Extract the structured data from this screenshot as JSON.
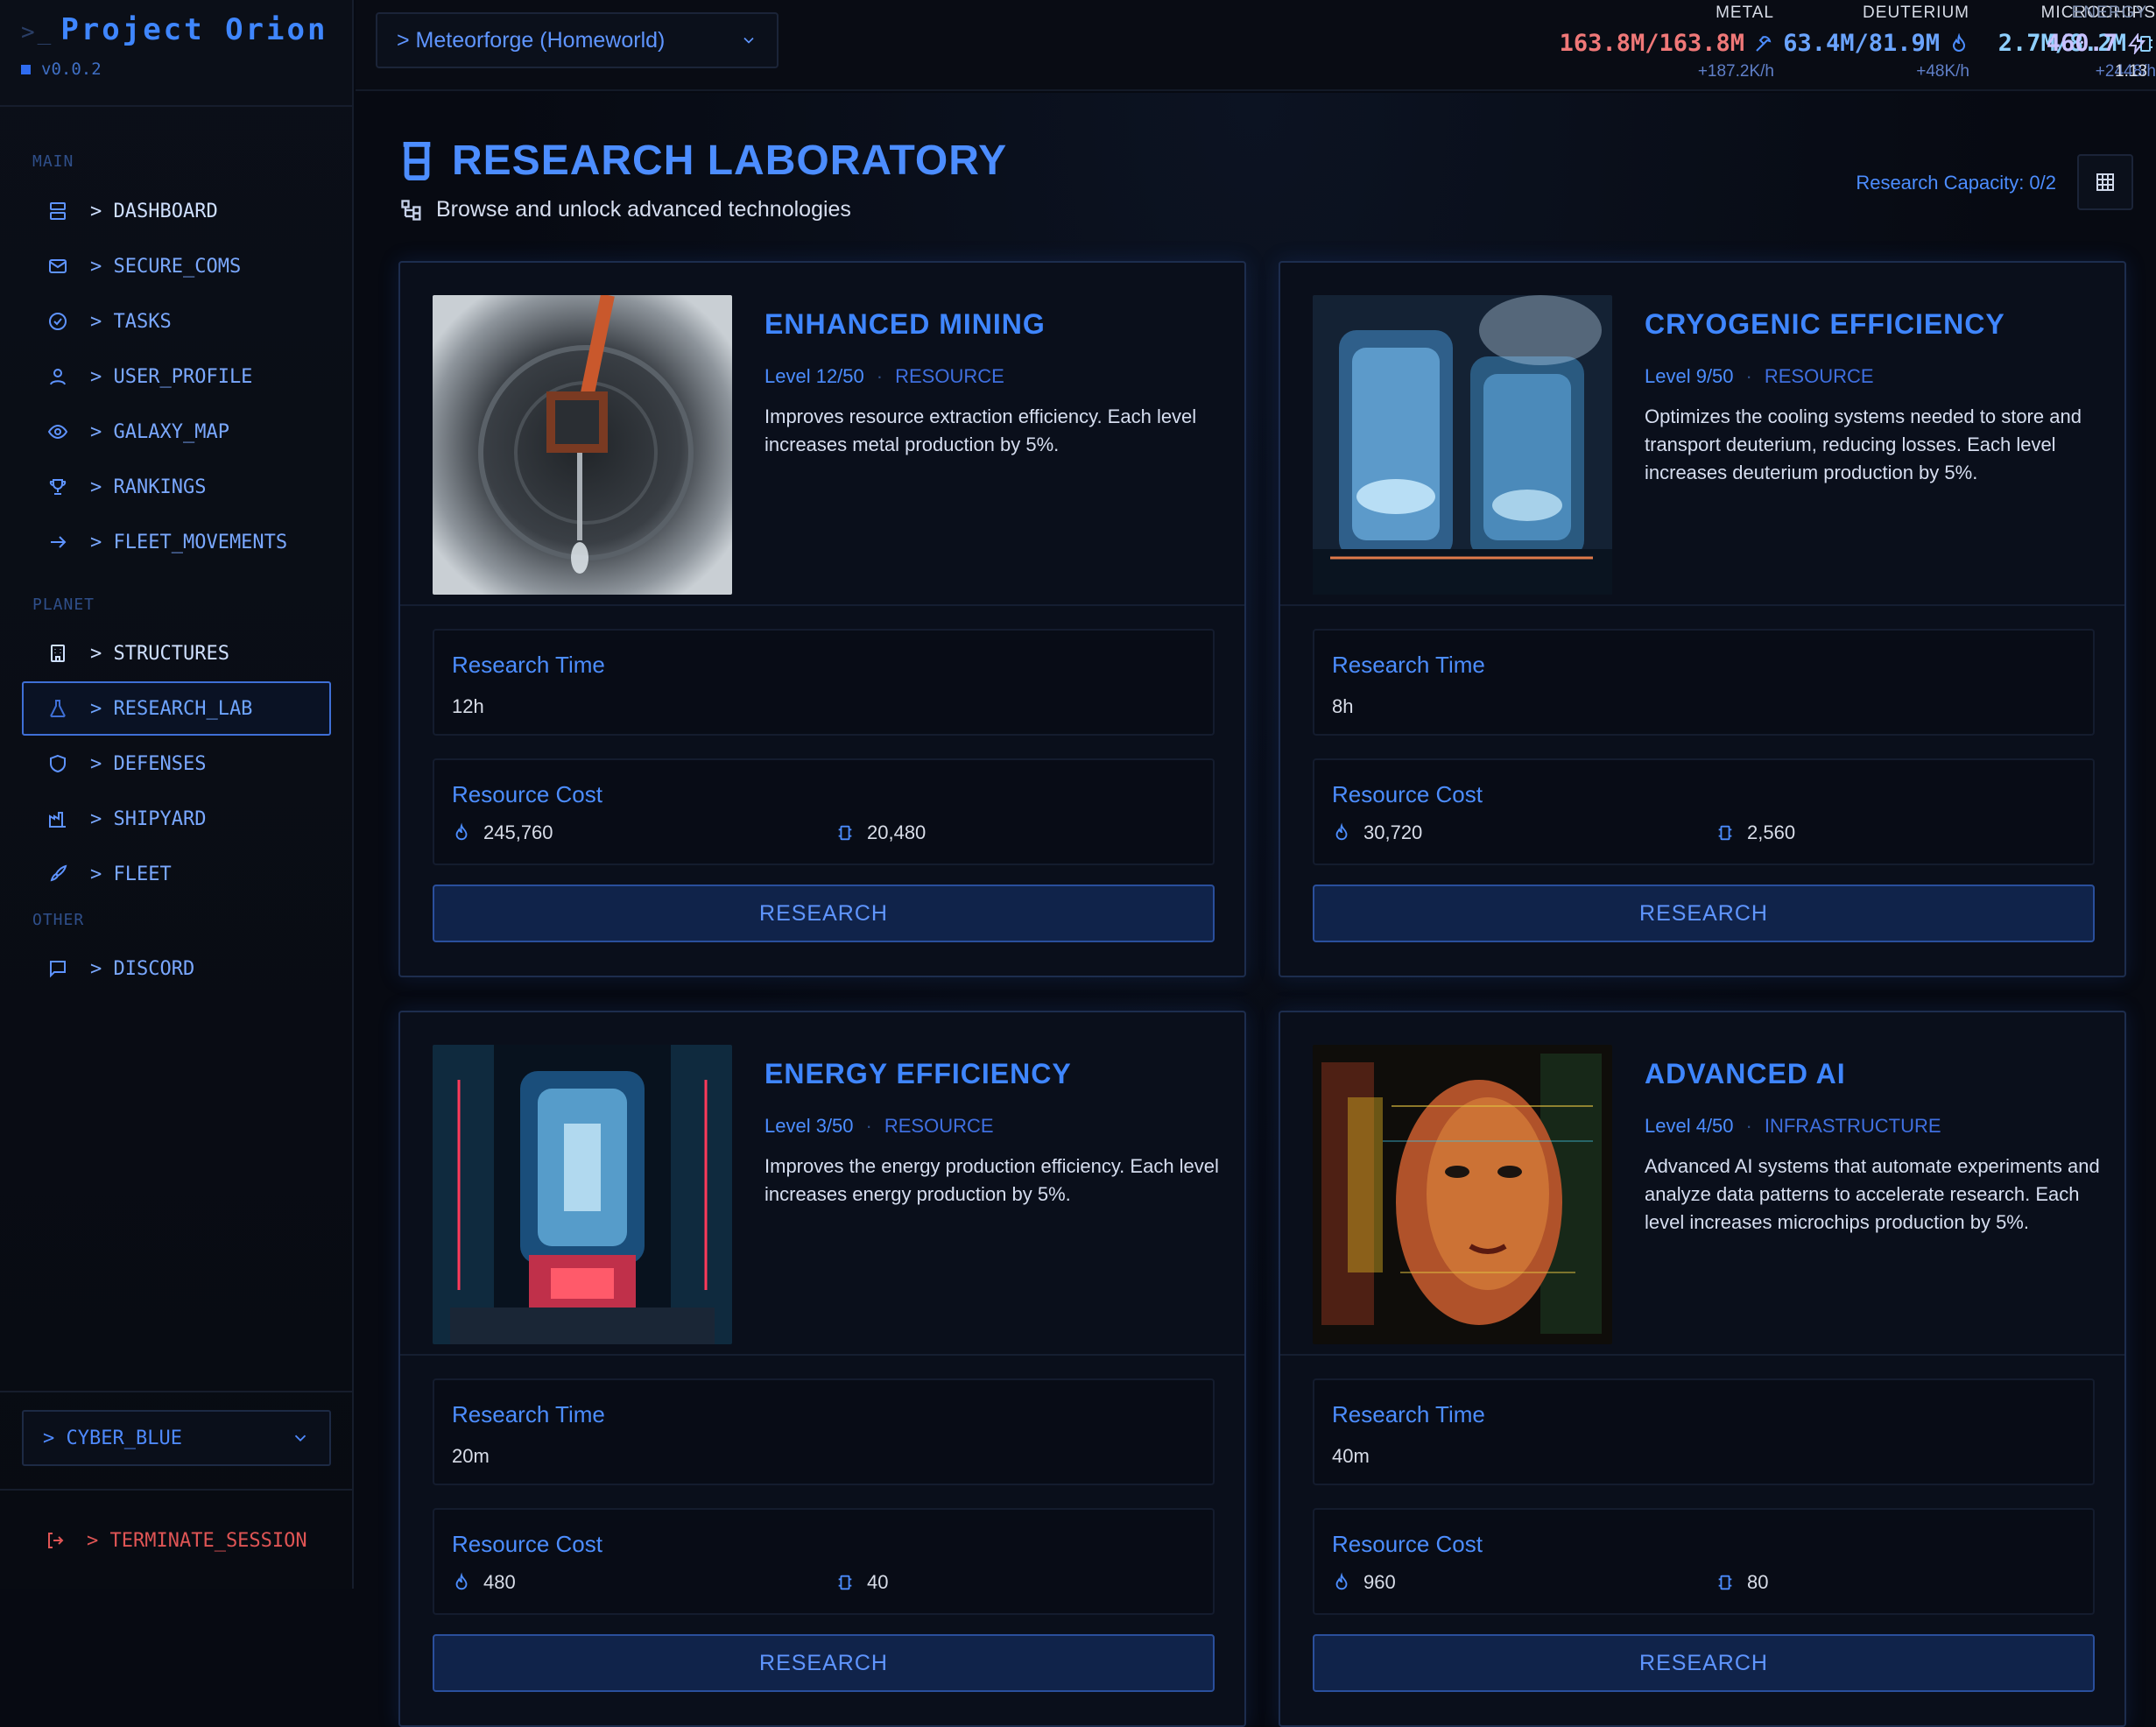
{
  "app": {
    "title": "Project Orion",
    "prompt": ">_",
    "version": "v0.0.2"
  },
  "sidebar": {
    "sections": {
      "main": "MAIN",
      "planet": "PLANET",
      "other": "OTHER"
    },
    "items": [
      {
        "label": "> DASHBOARD",
        "icon": "server-icon"
      },
      {
        "label": "> SECURE_COMS",
        "icon": "mail-icon"
      },
      {
        "label": "> TASKS",
        "icon": "check-circle-icon"
      },
      {
        "label": "> USER_PROFILE",
        "icon": "user-icon"
      },
      {
        "label": "> GALAXY_MAP",
        "icon": "eye-icon"
      },
      {
        "label": "> RANKINGS",
        "icon": "trophy-icon"
      },
      {
        "label": "> FLEET_MOVEMENTS",
        "icon": "arrow-right-icon"
      },
      {
        "label": "> STRUCTURES",
        "icon": "building-icon"
      },
      {
        "label": "> RESEARCH_LAB",
        "icon": "flask-icon"
      },
      {
        "label": "> DEFENSES",
        "icon": "shield-icon"
      },
      {
        "label": "> SHIPYARD",
        "icon": "factory-icon"
      },
      {
        "label": "> FLEET",
        "icon": "rocket-icon"
      },
      {
        "label": "> DISCORD",
        "icon": "chat-icon"
      }
    ],
    "theme": "> CYBER_BLUE",
    "logout": "> TERMINATE_SESSION"
  },
  "topbar": {
    "planet": "> Meteorforge (Homeworld)",
    "resources": {
      "metal": {
        "label": "METAL",
        "value": "163.8M/163.8M",
        "rate": "+187.2K/h",
        "color": "#f07878"
      },
      "deuterium": {
        "label": "DEUTERIUM",
        "value": "63.4M/81.9M",
        "rate": "+48K/h",
        "color": "#6aa4ff"
      },
      "microchips": {
        "label": "MICROCHIPS",
        "value": "2.7M/8.2M",
        "rate": "+2448/h",
        "color": "#8fd0ff"
      },
      "energy": {
        "label": "ENERGY",
        "value": "460.7",
        "rate": "1.13",
        "color": "#c8c2ff"
      }
    }
  },
  "page": {
    "title": "RESEARCH LABORATORY",
    "subtitle": "Browse and unlock advanced technologies",
    "capacity": "Research Capacity: 0/2"
  },
  "cards": [
    {
      "title": "ENHANCED MINING",
      "level": "Level 12/50",
      "category": "RESOURCE",
      "description": "Improves resource extraction efficiency. Each level increases metal production by 5%.",
      "time_label": "Research Time",
      "time": "12h",
      "cost_label": "Resource Cost",
      "cost_deuterium": "245,760",
      "cost_chips": "20,480",
      "button": "RESEARCH"
    },
    {
      "title": "CRYOGENIC EFFICIENCY",
      "level": "Level 9/50",
      "category": "RESOURCE",
      "description": "Optimizes the cooling systems needed to store and transport deuterium, reducing losses. Each level increases deuterium production by 5%.",
      "time_label": "Research Time",
      "time": "8h",
      "cost_label": "Resource Cost",
      "cost_deuterium": "30,720",
      "cost_chips": "2,560",
      "button": "RESEARCH"
    },
    {
      "title": "ENERGY EFFICIENCY",
      "level": "Level 3/50",
      "category": "RESOURCE",
      "description": "Improves the energy production efficiency. Each level increases energy production by 5%.",
      "time_label": "Research Time",
      "time": "20m",
      "cost_label": "Resource Cost",
      "cost_deuterium": "480",
      "cost_chips": "40",
      "button": "RESEARCH"
    },
    {
      "title": "ADVANCED AI",
      "level": "Level 4/50",
      "category": "INFRASTRUCTURE",
      "description": "Advanced AI systems that automate experiments and analyze data patterns to accelerate research. Each level increases microchips production by 5%.",
      "time_label": "Research Time",
      "time": "40m",
      "cost_label": "Resource Cost",
      "cost_deuterium": "960",
      "cost_chips": "80",
      "button": "RESEARCH"
    }
  ]
}
